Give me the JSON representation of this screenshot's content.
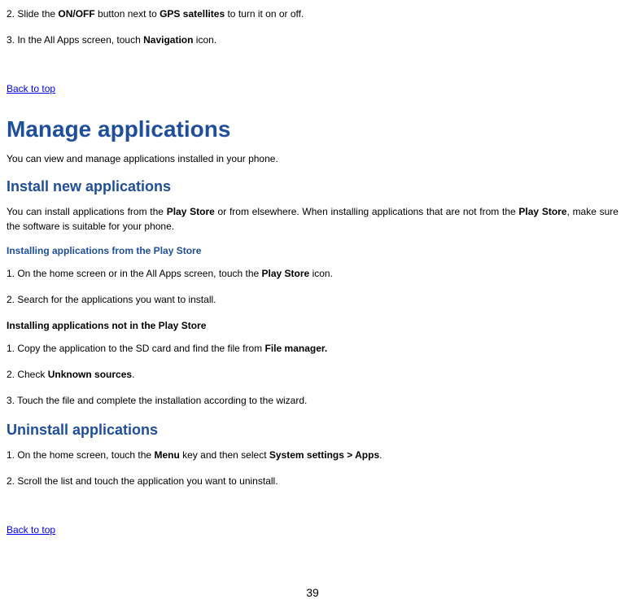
{
  "step2_pre": "2. Slide the ",
  "step2_b1": "ON/OFF",
  "step2_mid": " button next to ",
  "step2_b2": "GPS satellites",
  "step2_post": " to turn it on or off.",
  "step3_pre": "3. In the All Apps screen, touch ",
  "step3_b": "Navigation",
  "step3_post": " icon.",
  "back_top": "Back to top",
  "h1": "Manage applications",
  "intro1": "You can view and manage applications installed in your phone.",
  "h2_install": "Install new applications",
  "para_install_pre": "You can install applications from the ",
  "para_install_b1": "Play Store",
  "para_install_mid": " or from elsewhere. When installing applications that are not from the ",
  "para_install_b2": "Play Store",
  "para_install_post": ", make sure the software is suitable for your phone.",
  "h3_from_store": "Installing applications from the Play Store",
  "from_store_s1_pre": "1. On the home screen or in the All Apps screen, touch the ",
  "from_store_s1_b": "Play Store",
  "from_store_s1_post": " icon.",
  "from_store_s2": "2. Search for the applications you want to install.",
  "h3_not_store": "Installing applications not in the Play Store",
  "not_store_s1_pre": "1. Copy the application to the SD card and find the file from ",
  "not_store_s1_b": "File manager.",
  "not_store_s2_pre": "2. Check ",
  "not_store_s2_b": "Unknown sources",
  "not_store_s2_post": ".",
  "not_store_s3": "3. Touch the file and complete the installation according to the wizard.",
  "h2_uninstall": "Uninstall applications",
  "uninstall_s1_pre": "1. On the home screen, touch the ",
  "uninstall_s1_b1": "Menu",
  "uninstall_s1_mid": " key and then select ",
  "uninstall_s1_b2": "System settings > Apps",
  "uninstall_s1_post": ".",
  "uninstall_s2": "2. Scroll the list and touch the application you want to uninstall.",
  "page_num": "39"
}
